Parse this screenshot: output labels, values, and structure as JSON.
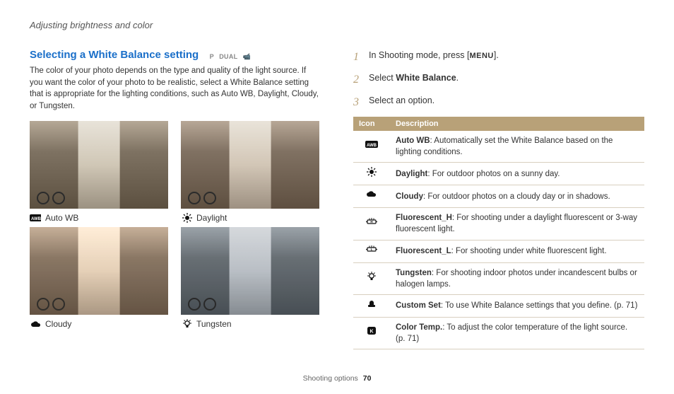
{
  "header": "Adjusting brightness and color",
  "title": "Selecting a White Balance setting",
  "modes": [
    "P",
    "DUAL",
    "📹"
  ],
  "intro": "The color of your photo depends on the type and quality of the light source. If you want the color of your photo to be realistic, select a White Balance setting that is appropriate for the lighting conditions, such as Auto WB, Daylight, Cloudy, or Tungsten.",
  "thumbs": [
    {
      "label": "Auto WB",
      "icon": "awb"
    },
    {
      "label": "Daylight",
      "icon": "sun"
    },
    {
      "label": "Cloudy",
      "icon": "cloud"
    },
    {
      "label": "Tungsten",
      "icon": "bulb"
    }
  ],
  "steps": {
    "s1_a": "In Shooting mode, press [",
    "s1_menu": "MENU",
    "s1_b": "].",
    "s2_a": "Select ",
    "s2_bold": "White Balance",
    "s2_b": ".",
    "s3": "Select an option."
  },
  "table": {
    "headers": [
      "Icon",
      "Description"
    ],
    "rows": [
      {
        "icon": "awb",
        "bold": "Auto WB",
        "text": ": Automatically set the White Balance based on the lighting conditions."
      },
      {
        "icon": "sun",
        "bold": "Daylight",
        "text": ": For outdoor photos on a sunny day."
      },
      {
        "icon": "cloud",
        "bold": "Cloudy",
        "text": ": For outdoor photos on a cloudy day or in shadows."
      },
      {
        "icon": "flh",
        "bold": "Fluorescent_H",
        "text": ": For shooting under a daylight fluorescent or 3-way fluorescent light."
      },
      {
        "icon": "fll",
        "bold": "Fluorescent_L",
        "text": ": For shooting under white fluorescent light."
      },
      {
        "icon": "bulb",
        "bold": "Tungsten",
        "text": ": For shooting indoor photos under incandescent bulbs or halogen lamps."
      },
      {
        "icon": "custom",
        "bold": "Custom Set",
        "text": ": To use White Balance settings that you define. (p. 71)"
      },
      {
        "icon": "k",
        "bold": "Color Temp.",
        "text": ": To adjust the color temperature of the light source. (p. 71)"
      }
    ]
  },
  "footer": {
    "section": "Shooting options",
    "page": "70"
  }
}
